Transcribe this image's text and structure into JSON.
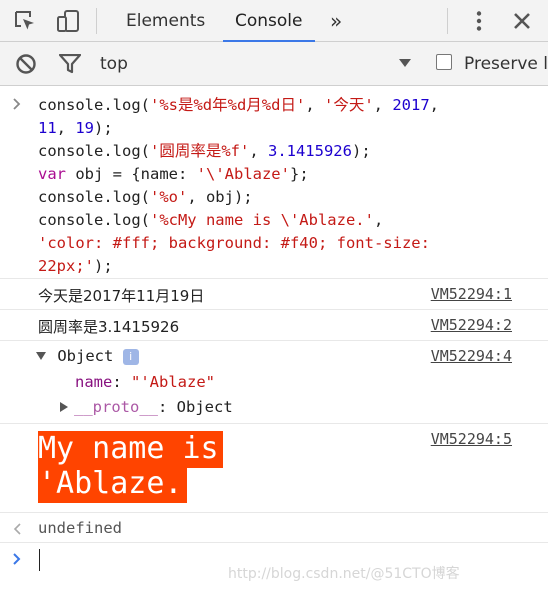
{
  "toolbar": {
    "tabs": [
      "Elements",
      "Console"
    ],
    "active_tab": "Console",
    "more_tabs": "»",
    "context": "top",
    "preserve_log_label": "Preserve l"
  },
  "input_lines": [
    [
      [
        "fn",
        "console.log("
      ],
      [
        "str",
        "'%s是%d年%d月%d日'"
      ],
      [
        "fn",
        ", "
      ],
      [
        "str",
        "'今天'"
      ],
      [
        "fn",
        ", "
      ],
      [
        "num",
        "2017"
      ],
      [
        "fn",
        ","
      ]
    ],
    [
      [
        "num",
        "11"
      ],
      [
        "fn",
        ", "
      ],
      [
        "num",
        "19"
      ],
      [
        "fn",
        ");"
      ]
    ],
    [
      [
        "fn",
        "console.log("
      ],
      [
        "str",
        "'圆周率是%f'"
      ],
      [
        "fn",
        ", "
      ],
      [
        "num",
        "3.1415926"
      ],
      [
        "fn",
        ");"
      ]
    ],
    [
      [
        "kw",
        "var"
      ],
      [
        "fn",
        " obj = {name: "
      ],
      [
        "str",
        "'\\'Ablaze'"
      ],
      [
        "fn",
        "};"
      ]
    ],
    [
      [
        "fn",
        "console.log("
      ],
      [
        "str",
        "'%o'"
      ],
      [
        "fn",
        ", obj);"
      ]
    ],
    [
      [
        "fn",
        "console.log("
      ],
      [
        "str",
        "'%cMy name is \\'Ablaze.'"
      ],
      [
        "fn",
        ","
      ]
    ],
    [
      [
        "str",
        "'color: #fff; background: #f40; font-size:"
      ]
    ],
    [
      [
        "str",
        "22px;'"
      ],
      [
        "fn",
        ");"
      ]
    ]
  ],
  "log1": {
    "text": "今天是2017年11月19日",
    "source": "VM52294:1"
  },
  "log2": {
    "text": "圆周率是3.1415926",
    "source": "VM52294:2"
  },
  "log3": {
    "label": "Object",
    "info_badge": "i",
    "prop_name": "name",
    "prop_value": "\"'Ablaze\"",
    "proto_name": "__proto__",
    "proto_value": "Object",
    "source": "VM52294:4"
  },
  "log4": {
    "line1": "My name is ",
    "line2": "'Ablaze.",
    "source": "VM52294:5"
  },
  "result": {
    "text": "undefined"
  },
  "watermark": "http://blog.csdn.net/@51CTO博客"
}
